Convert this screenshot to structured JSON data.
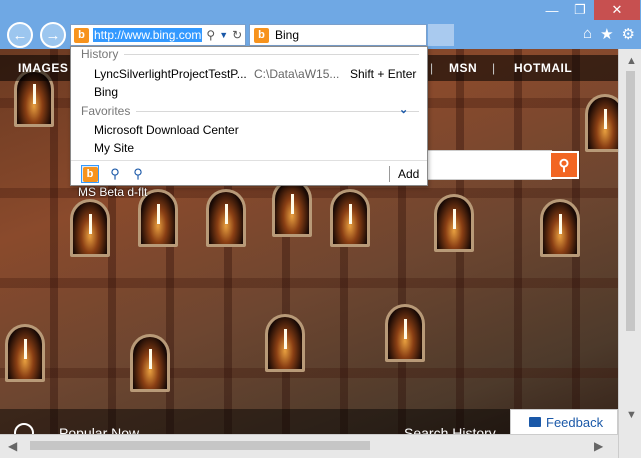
{
  "browser": {
    "back_icon": "arrow-left-icon",
    "forward_icon": "arrow-right-icon",
    "address": {
      "url": "http://www.bing.com",
      "site_icon": "bing-icon"
    },
    "tab": {
      "label": "Bing"
    },
    "titlebar": {
      "minimize": "—",
      "restore": "❐",
      "close": "✕"
    },
    "toolbar_icons": [
      "home-icon",
      "favorites-star-icon",
      "settings-gear-icon"
    ]
  },
  "page": {
    "nav": {
      "images": "IMAGES",
      "separator": "|",
      "msn": "MSN",
      "hotmail": "HOTMAIL"
    },
    "beta_label": "MS Beta d-flt",
    "bottom": {
      "popular": "Popular Now",
      "search_history": "Search History"
    },
    "feedback": "Feedback"
  },
  "dropdown": {
    "history_header": "History",
    "history": [
      {
        "title": "LyncSilverlightProjectTestP...",
        "path": "C:\\Data\\aW15...",
        "shortcut": "Shift + Enter"
      },
      {
        "title": "Bing",
        "path": "",
        "shortcut": ""
      }
    ],
    "favorites_header": "Favorites",
    "favorites": [
      {
        "title": "Microsoft Download Center"
      },
      {
        "title": "My Site"
      }
    ],
    "add_label": "Add"
  },
  "colors": {
    "accent": "#f26522",
    "chrome": "#6fa8e4",
    "link": "#1a58a8",
    "close": "#c75050"
  }
}
